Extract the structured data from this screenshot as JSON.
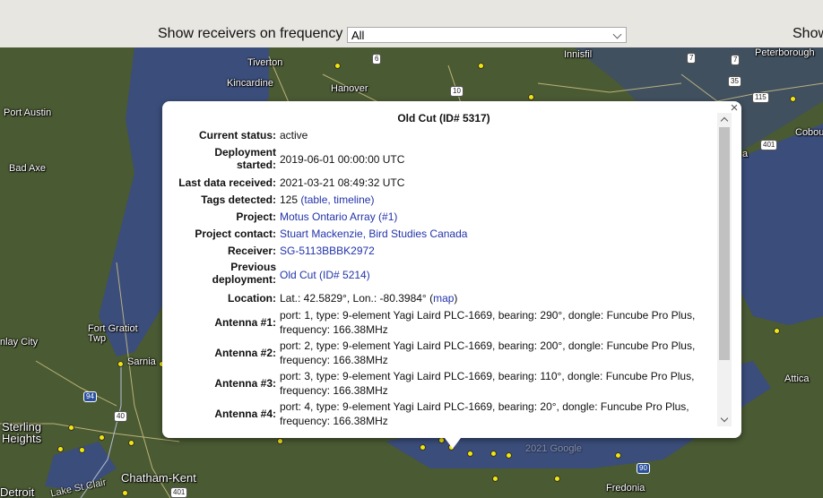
{
  "toolbar": {
    "frequency_label": "Show receivers on frequency",
    "frequency_selected": "All",
    "right_label_fragment": "Show"
  },
  "map": {
    "places": [
      "Tiverton",
      "Kincardine",
      "Hanover",
      "Port Austin",
      "Bad Axe",
      "Fort Gratiot Twp",
      "Sarnia",
      "nlay City",
      "Sterling Heights",
      "Chatham-Kent",
      "Detroit",
      "Lake St Clair",
      "Fredonia",
      "Attica",
      "Peterborough",
      "Cobou",
      "Innisfil",
      "a"
    ],
    "route_shields": [
      "6",
      "10",
      "7",
      "7",
      "35",
      "115",
      "401",
      "94",
      "40",
      "401",
      "90"
    ],
    "watermark": "2021 Google"
  },
  "info": {
    "title": "Old Cut (ID# 5317)",
    "close_glyph": "×",
    "rows": {
      "status": {
        "label": "Current status:",
        "value": "active"
      },
      "deployment": {
        "label": "Deployment started:",
        "value": "2019-06-01 00:00:00 UTC"
      },
      "last_data": {
        "label": "Last data received:",
        "value": "2021-03-21 08:49:32 UTC"
      },
      "tags": {
        "label": "Tags detected:",
        "count": "125",
        "open_paren": " (",
        "link_table": "table",
        "sep": ", ",
        "link_timeline": "timeline",
        "close_paren": ")"
      },
      "project": {
        "label": "Project:",
        "value": "Motus Ontario Array (#1)"
      },
      "contact": {
        "label": "Project contact:",
        "value": "Stuart Mackenzie, Bird Studies Canada"
      },
      "receiver": {
        "label": "Receiver:",
        "value": "SG-5113BBBK2972"
      },
      "previous": {
        "label": "Previous deployment:",
        "value": "Old Cut (ID# 5214)"
      },
      "location": {
        "label": "Location:",
        "value": "Lat.: 42.5829°, Lon.: -80.3984°",
        "open_paren": " (",
        "link_map": "map",
        "close_paren": ")"
      },
      "antenna1": {
        "label": "Antenna #1:",
        "line1": "port: 1, type: 9-element Yagi Laird PLC-1669, bearing: 290°, dongle: Funcube Pro Plus,",
        "line2": "frequency: 166.38MHz"
      },
      "antenna2": {
        "label": "Antenna #2:",
        "line1": "port: 2, type: 9-element Yagi Laird PLC-1669, bearing: 200°, dongle: Funcube Pro Plus,",
        "line2": "frequency: 166.38MHz"
      },
      "antenna3": {
        "label": "Antenna #3:",
        "line1": "port: 3, type: 9-element Yagi Laird PLC-1669, bearing: 110°, dongle: Funcube Pro Plus,",
        "line2": "frequency: 166.38MHz"
      },
      "antenna4": {
        "label": "Antenna #4:",
        "line1": "port: 4, type: 9-element Yagi Laird PLC-1669, bearing: 20°, dongle: Funcube Pro Plus,",
        "line2": "frequency: 166.38MHz"
      }
    }
  },
  "colors": {
    "link": "#2233aa",
    "receiver_marker": "#f2e60b",
    "water": "#3b4d7a",
    "land": "#4a5a33"
  }
}
